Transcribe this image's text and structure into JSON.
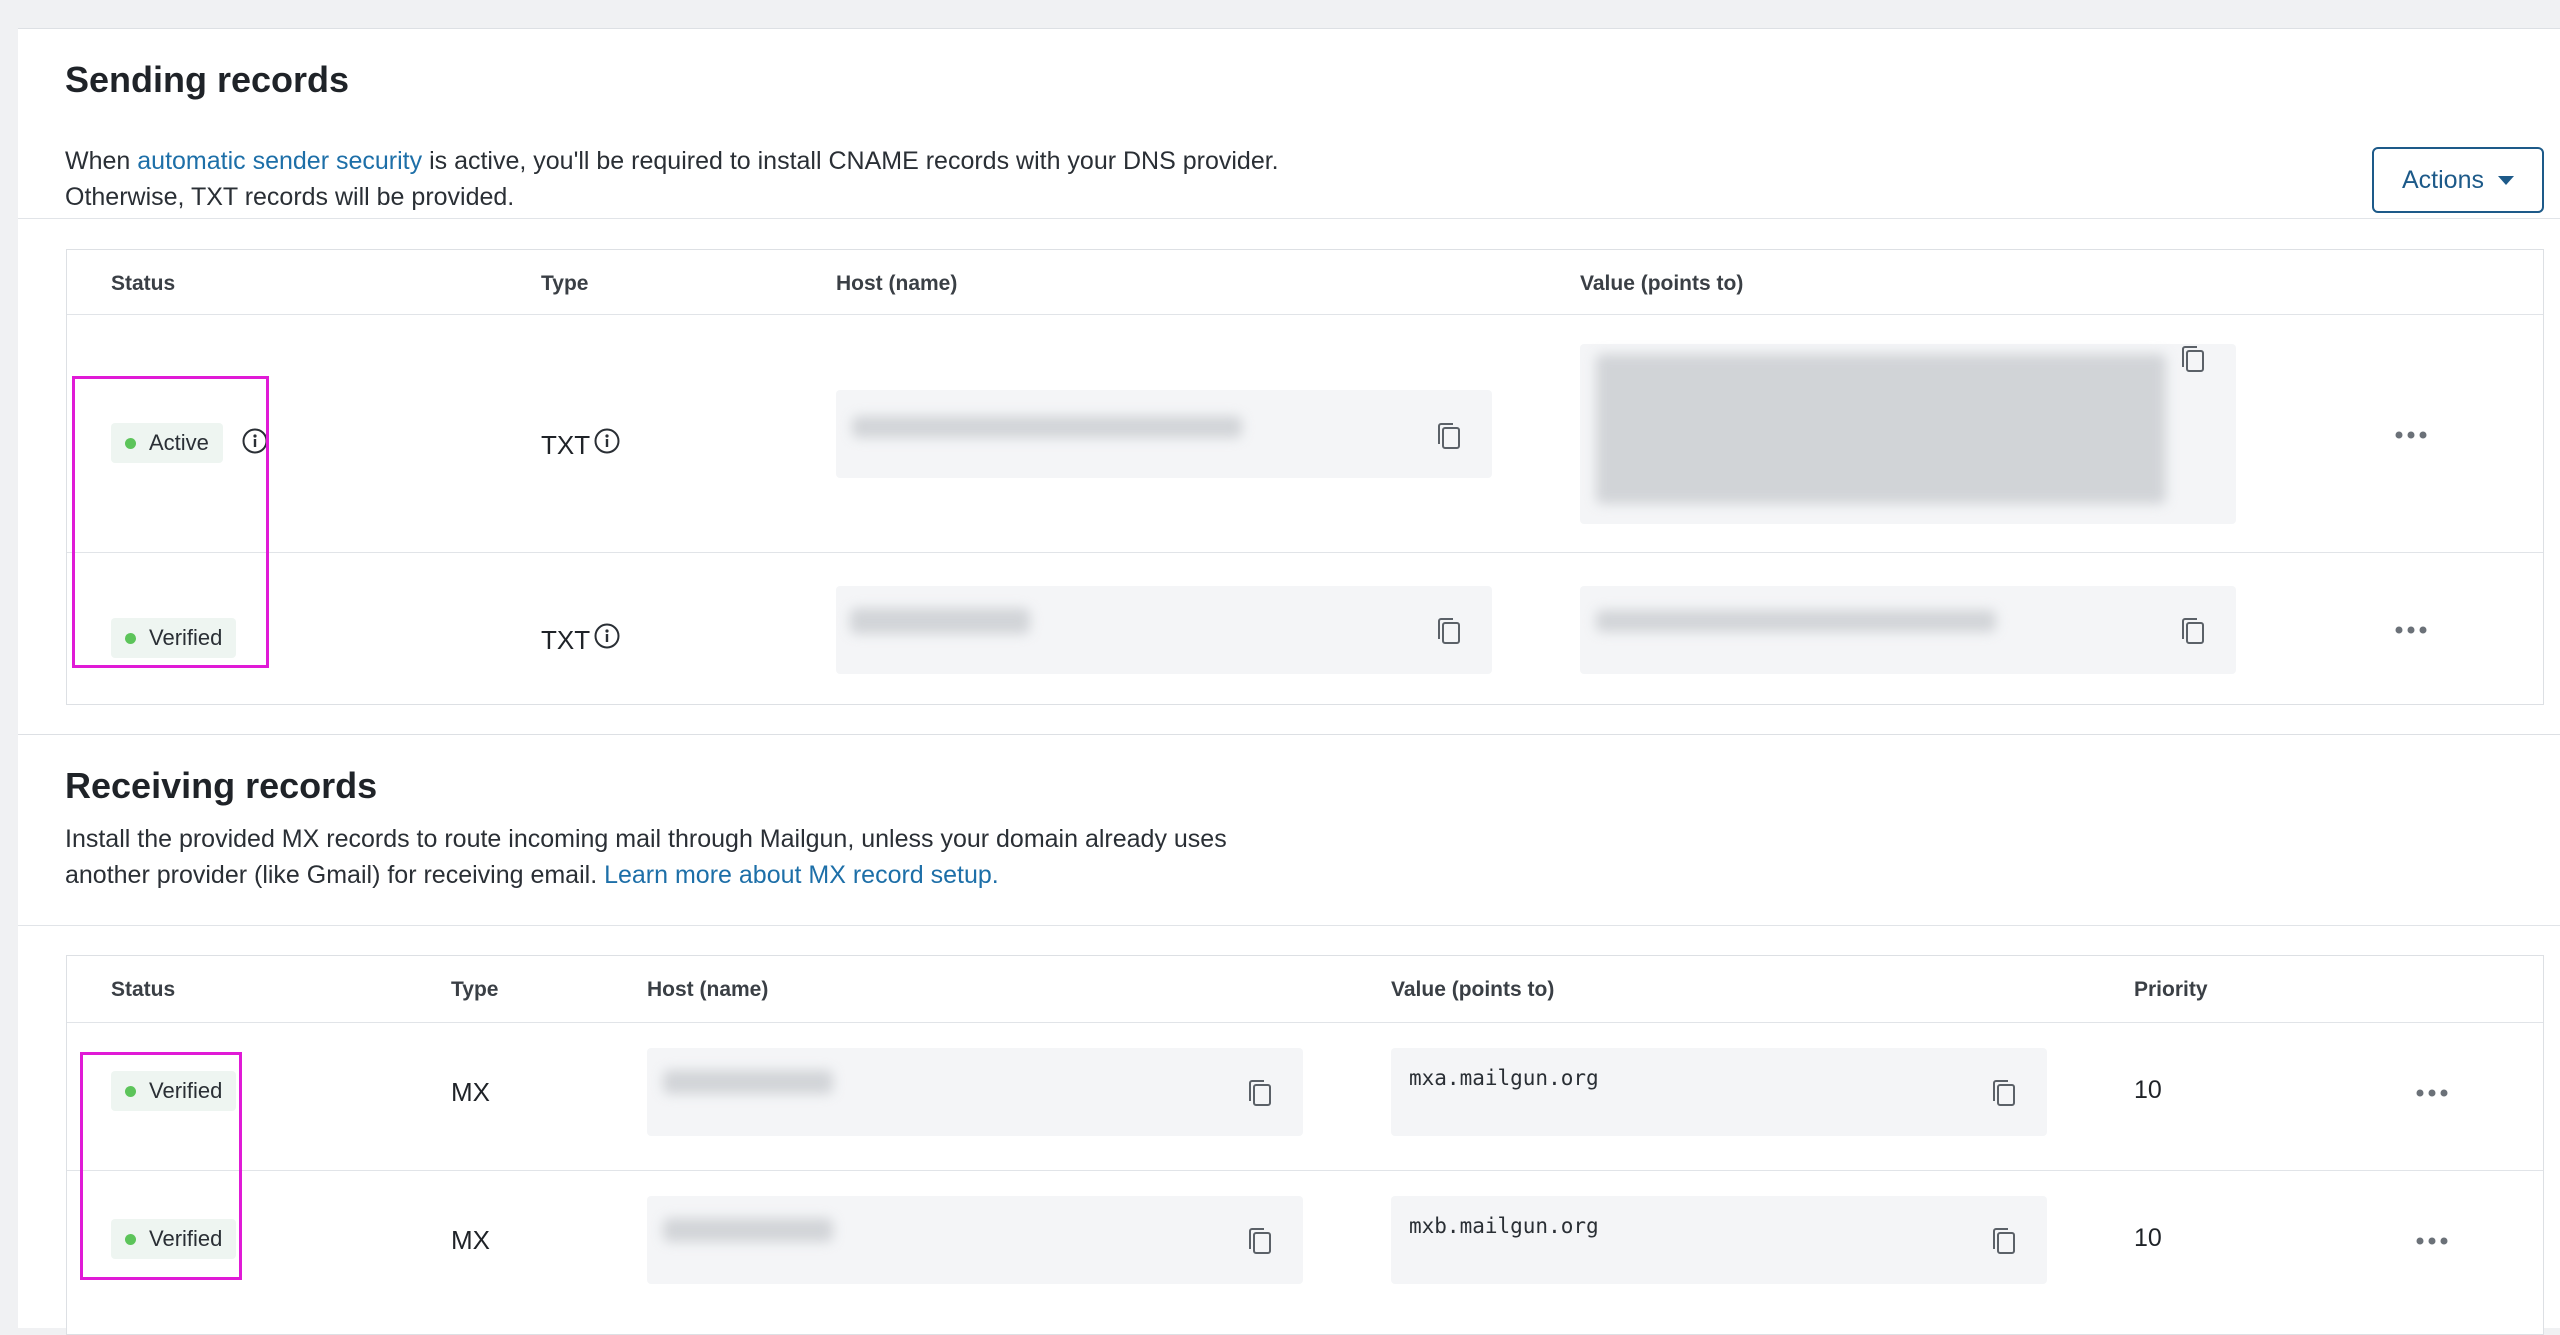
{
  "sending": {
    "title": "Sending records",
    "desc_before_link": "When ",
    "desc_link": "automatic sender security",
    "desc_after_link": " is active, you'll be required to install CNAME records with your DNS provider.",
    "desc_line2": "Otherwise, TXT records will be provided.",
    "actions_label": "Actions",
    "columns": {
      "status": "Status",
      "type": "Type",
      "host": "Host (name)",
      "value": "Value (points to)"
    },
    "rows": [
      {
        "status": "Active",
        "type": "TXT"
      },
      {
        "status": "Verified",
        "type": "TXT"
      }
    ]
  },
  "receiving": {
    "title": "Receiving records",
    "desc_line1": "Install the provided MX records to route incoming mail through Mailgun, unless your domain already uses",
    "desc_line2_before_link": "another provider (like Gmail) for receiving email. ",
    "desc_link": "Learn more about MX record setup.",
    "columns": {
      "status": "Status",
      "type": "Type",
      "host": "Host (name)",
      "value": "Value (points to)",
      "priority": "Priority"
    },
    "rows": [
      {
        "status": "Verified",
        "type": "MX",
        "value": "mxa.mailgun.org",
        "priority": "10"
      },
      {
        "status": "Verified",
        "type": "MX",
        "value": "mxb.mailgun.org",
        "priority": "10"
      }
    ]
  },
  "colors": {
    "accent": "#1d5a89",
    "link": "#1d6fa8",
    "status_dot": "#5cc45a",
    "highlight": "#e01ad6"
  },
  "icons": [
    "info-icon",
    "copy-icon",
    "more-horizontal-icon",
    "caret-down-icon"
  ]
}
